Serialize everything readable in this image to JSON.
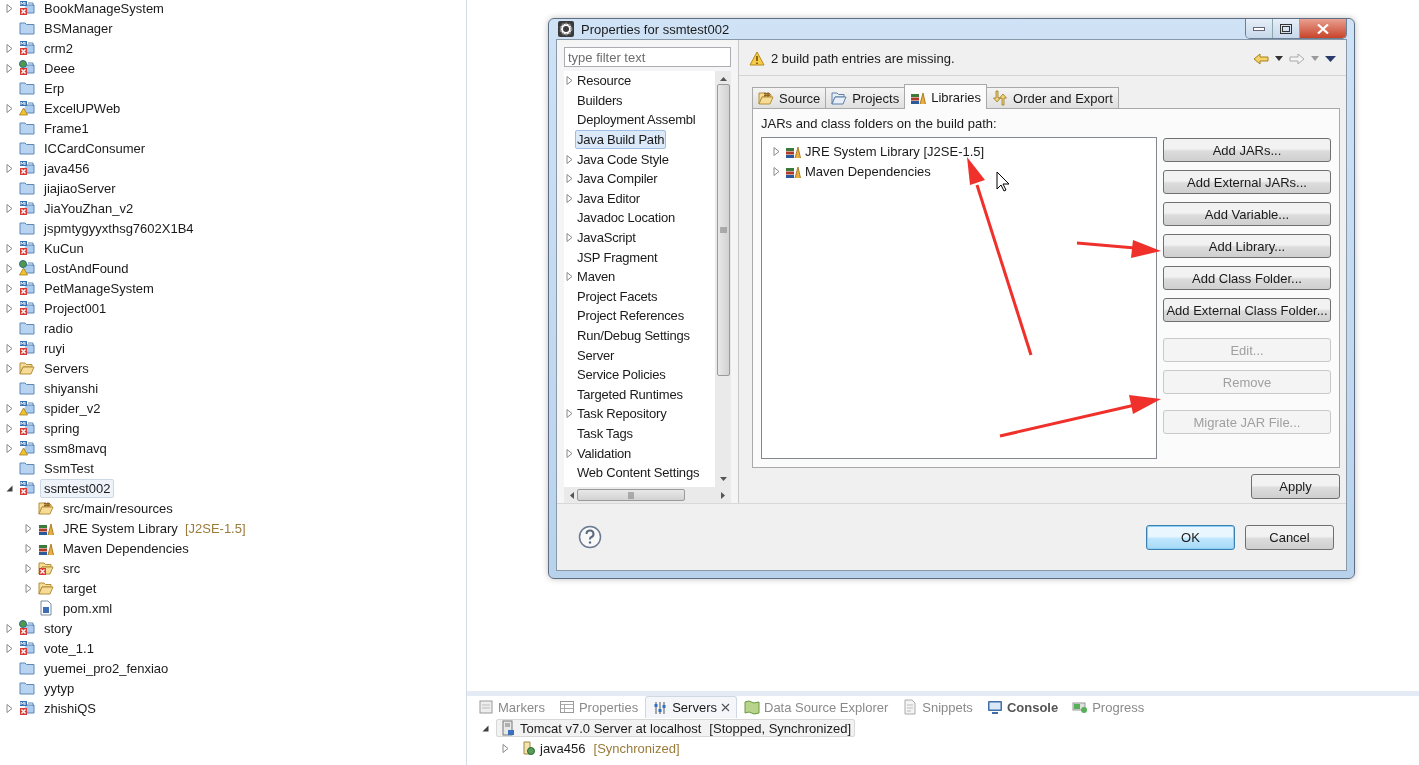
{
  "project_explorer": {
    "items": [
      {
        "label": "BookManageSystem",
        "kind": "maven-error",
        "expanded": false,
        "selected": false
      },
      {
        "label": "BSManager",
        "kind": "folder",
        "selected": false
      },
      {
        "label": "crm2",
        "kind": "maven-error",
        "expanded": false,
        "selected": false
      },
      {
        "label": "Deee",
        "kind": "web-error",
        "expanded": false,
        "selected": false
      },
      {
        "label": "Erp",
        "kind": "folder",
        "selected": false
      },
      {
        "label": "ExcelUPWeb",
        "kind": "maven-warning",
        "expanded": false,
        "selected": false
      },
      {
        "label": "Frame1",
        "kind": "folder",
        "selected": false
      },
      {
        "label": "ICCardConsumer",
        "kind": "folder",
        "selected": false
      },
      {
        "label": "java456",
        "kind": "maven-error",
        "expanded": false,
        "selected": false
      },
      {
        "label": "jiajiaoServer",
        "kind": "folder",
        "selected": false
      },
      {
        "label": "JiaYouZhan_v2",
        "kind": "maven-error",
        "expanded": false,
        "selected": false
      },
      {
        "label": "jspmtygyyxthsg7602X1B4",
        "kind": "folder",
        "selected": false
      },
      {
        "label": "KuCun",
        "kind": "maven-error",
        "expanded": false,
        "selected": false
      },
      {
        "label": "LostAndFound",
        "kind": "web-warning",
        "expanded": false,
        "selected": false
      },
      {
        "label": "PetManageSystem",
        "kind": "maven-error",
        "expanded": false,
        "selected": false
      },
      {
        "label": "Project001",
        "kind": "maven-error",
        "expanded": false,
        "selected": false
      },
      {
        "label": "radio",
        "kind": "folder",
        "selected": false
      },
      {
        "label": "ruyi",
        "kind": "maven-error",
        "expanded": false,
        "selected": false
      },
      {
        "label": "Servers",
        "kind": "open-folder",
        "expanded": false,
        "selected": false
      },
      {
        "label": "shiyanshi",
        "kind": "folder",
        "selected": false
      },
      {
        "label": "spider_v2",
        "kind": "maven-warning",
        "expanded": false,
        "selected": false
      },
      {
        "label": "spring",
        "kind": "maven-error",
        "expanded": false,
        "selected": false
      },
      {
        "label": "ssm8mavq",
        "kind": "maven-warning",
        "expanded": false,
        "selected": false
      },
      {
        "label": "SsmTest",
        "kind": "folder",
        "selected": false
      },
      {
        "label": "ssmtest002",
        "kind": "maven-error",
        "expanded": true,
        "selected": true,
        "children": [
          {
            "label": "src/main/resources",
            "kind": "source-folder",
            "selected": false
          },
          {
            "label": "JRE System Library",
            "decoration": "[J2SE-1.5]",
            "kind": "library",
            "expanded": false,
            "selected": false
          },
          {
            "label": "Maven Dependencies",
            "kind": "library",
            "expanded": false,
            "selected": false
          },
          {
            "label": "src",
            "kind": "open-folder-error",
            "expanded": false,
            "selected": false
          },
          {
            "label": "target",
            "kind": "open-folder",
            "expanded": false,
            "selected": false
          },
          {
            "label": "pom.xml",
            "kind": "pom",
            "selected": false
          }
        ]
      },
      {
        "label": "story",
        "kind": "web-error",
        "expanded": false,
        "selected": false
      },
      {
        "label": "vote_1.1",
        "kind": "maven-error",
        "expanded": false,
        "selected": false
      },
      {
        "label": "yuemei_pro2_fenxiao",
        "kind": "folder",
        "selected": false
      },
      {
        "label": "yytyp",
        "kind": "folder",
        "selected": false
      },
      {
        "label": "zhishiQS",
        "kind": "maven-error",
        "expanded": false,
        "selected": false
      }
    ]
  },
  "dialog": {
    "title": "Properties for ssmtest002",
    "filter": {
      "placeholder": "type filter text"
    },
    "categories": [
      {
        "label": "Resource",
        "expanded": false,
        "selected": false
      },
      {
        "label": "Builders",
        "selected": false
      },
      {
        "label": "Deployment Assembl",
        "selected": false
      },
      {
        "label": "Java Build Path",
        "selected": true
      },
      {
        "label": "Java Code Style",
        "expanded": false,
        "selected": false
      },
      {
        "label": "Java Compiler",
        "expanded": false,
        "selected": false
      },
      {
        "label": "Java Editor",
        "expanded": false,
        "selected": false
      },
      {
        "label": "Javadoc Location",
        "selected": false
      },
      {
        "label": "JavaScript",
        "expanded": false,
        "selected": false
      },
      {
        "label": "JSP Fragment",
        "selected": false
      },
      {
        "label": "Maven",
        "expanded": false,
        "selected": false
      },
      {
        "label": "Project Facets",
        "selected": false
      },
      {
        "label": "Project References",
        "selected": false
      },
      {
        "label": "Run/Debug Settings",
        "selected": false
      },
      {
        "label": "Server",
        "selected": false
      },
      {
        "label": "Service Policies",
        "selected": false
      },
      {
        "label": "Targeted Runtimes",
        "selected": false
      },
      {
        "label": "Task Repository",
        "expanded": false,
        "selected": false
      },
      {
        "label": "Task Tags",
        "selected": false
      },
      {
        "label": "Validation",
        "expanded": false,
        "selected": false
      },
      {
        "label": "Web Content Settings",
        "selected": false
      }
    ],
    "message": "2 build path entries are missing.",
    "tabs": [
      {
        "label": "Source",
        "kind": "source",
        "selected": false
      },
      {
        "label": "Projects",
        "kind": "projects",
        "selected": false
      },
      {
        "label": "Libraries",
        "kind": "libraries",
        "selected": true
      },
      {
        "label": "Order and Export",
        "kind": "order",
        "selected": false
      }
    ],
    "list_label": "JARs and class folders on the build path:",
    "entries": [
      {
        "label": "JRE System Library [J2SE-1.5]",
        "expanded": false
      },
      {
        "label": "Maven Dependencies",
        "expanded": false
      }
    ],
    "side_buttons": [
      [
        {
          "label": "Add JARs...",
          "disabled": false
        },
        {
          "label": "Add External JARs...",
          "disabled": false
        },
        {
          "label": "Add Variable...",
          "disabled": false
        },
        {
          "label": "Add Library...",
          "disabled": false
        },
        {
          "label": "Add Class Folder...",
          "disabled": false
        },
        {
          "label": "Add External Class Folder...",
          "disabled": false
        }
      ],
      [
        {
          "label": "Edit...",
          "disabled": true
        },
        {
          "label": "Remove",
          "disabled": true
        }
      ],
      [
        {
          "label": "Migrate JAR File...",
          "disabled": true
        }
      ]
    ],
    "apply": "Apply",
    "ok": "OK",
    "cancel": "Cancel"
  },
  "bottom_panel": {
    "tabs": [
      {
        "label": "Markers",
        "kind": "markers",
        "selected": false,
        "bold": false
      },
      {
        "label": "Properties",
        "kind": "properties",
        "selected": false,
        "bold": false
      },
      {
        "label": "Servers",
        "kind": "servers",
        "selected": true,
        "bold": false
      },
      {
        "label": "Data Source Explorer",
        "kind": "datasource",
        "selected": false,
        "bold": false
      },
      {
        "label": "Snippets",
        "kind": "snippets",
        "selected": false,
        "bold": false
      },
      {
        "label": "Console",
        "kind": "console",
        "selected": false,
        "bold": true
      },
      {
        "label": "Progress",
        "kind": "progress",
        "selected": false,
        "bold": false
      }
    ],
    "servers": [
      {
        "label": "Tomcat v7.0 Server at localhost",
        "status": "[Stopped, Synchronized]",
        "expanded": true,
        "selected": true,
        "children": [
          {
            "label": "java456",
            "status": "[Synchronized]",
            "expanded": false,
            "selected": false
          }
        ]
      }
    ]
  }
}
